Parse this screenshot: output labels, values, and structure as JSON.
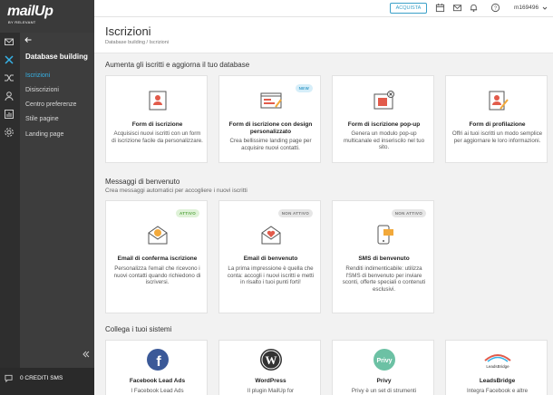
{
  "app": {
    "logo": "mailUp",
    "logo_sub": "BY RELEVANT",
    "buy_label": "ACQUISTA",
    "user": "m169496"
  },
  "sidebar": {
    "title": "Database building",
    "items": [
      {
        "label": "Iscrizioni",
        "active": true
      },
      {
        "label": "Disiscrizioni",
        "active": false
      },
      {
        "label": "Centro preferenze",
        "active": false
      },
      {
        "label": "Stile pagine",
        "active": false
      },
      {
        "label": "Landing page",
        "active": false
      }
    ],
    "credits": "0 CREDITI SMS"
  },
  "page": {
    "title": "Iscrizioni",
    "breadcrumb": "Database building  /  Iscrizioni"
  },
  "sections": [
    {
      "title": "Aumenta gli iscritti e aggiorna il tuo database",
      "subtitle": "",
      "cards": [
        {
          "icon": "signup-form-icon",
          "badge": "",
          "title": "Form di iscrizione",
          "desc": "Acquisisci nuovi iscritti con un form di iscrizione facile da personalizzare."
        },
        {
          "icon": "custom-design-form-icon",
          "badge": "NEW",
          "title": "Form di iscrizione con design personalizzato",
          "desc": "Crea bellissime landing page per acquisire nuovi contatti."
        },
        {
          "icon": "popup-form-icon",
          "badge": "",
          "title": "Form di iscrizione pop-up",
          "desc": "Genera un modulo pop-up multicanale ed inseriscilo nel tuo sito."
        },
        {
          "icon": "profiling-form-icon",
          "badge": "",
          "title": "Form di profilazione",
          "desc": "Offri ai tuoi iscritti un modo semplice per aggiornare le loro informazioni."
        }
      ]
    },
    {
      "title": "Messaggi di benvenuto",
      "subtitle": "Crea messaggi automatici per accogliere i nuovi iscritti",
      "cards": [
        {
          "icon": "confirmation-email-icon",
          "badge": "ATTIVO",
          "title": "Email di conferma iscrizione",
          "desc": "Personalizza l'email che ricevono i nuovi contatti quando richiedono di iscriversi."
        },
        {
          "icon": "welcome-email-icon",
          "badge": "NON ATTIVO",
          "title": "Email di benvenuto",
          "desc": "La prima impressione è quella che conta: accogli i nuovi iscritti e metti in risalto i tuoi punti forti!"
        },
        {
          "icon": "welcome-sms-icon",
          "badge": "NON ATTIVO",
          "title": "SMS di benvenuto",
          "desc": "Renditi indimenticabile: utilizza l'SMS di benvenuto per inviare sconti, offerte speciali o contenuti esclusivi."
        }
      ]
    },
    {
      "title": "Collega i tuoi sistemi",
      "subtitle": "",
      "cards": [
        {
          "icon": "facebook-logo-icon",
          "badge": "",
          "title": "Facebook Lead Ads",
          "desc": "I Facebook Lead Ads"
        },
        {
          "icon": "wordpress-logo-icon",
          "badge": "",
          "title": "WordPress",
          "desc": "Il plugin MailUp for"
        },
        {
          "icon": "privy-logo-icon",
          "logo_text": "Privy",
          "badge": "",
          "title": "Privy",
          "desc": "Privy è un set di strumenti"
        },
        {
          "icon": "leadsbridge-logo-icon",
          "logo_text": "LeadsBridge",
          "badge": "",
          "title": "LeadsBridge",
          "desc": "Integra Facebook e altre"
        }
      ]
    }
  ],
  "colors": {
    "accent": "#37b3e8",
    "dark_rail": "#2e2e2e",
    "sidebar": "#3d3d3d",
    "icon_red": "#e25b4b",
    "icon_orange": "#f2a93b",
    "facebook": "#3b5998"
  }
}
